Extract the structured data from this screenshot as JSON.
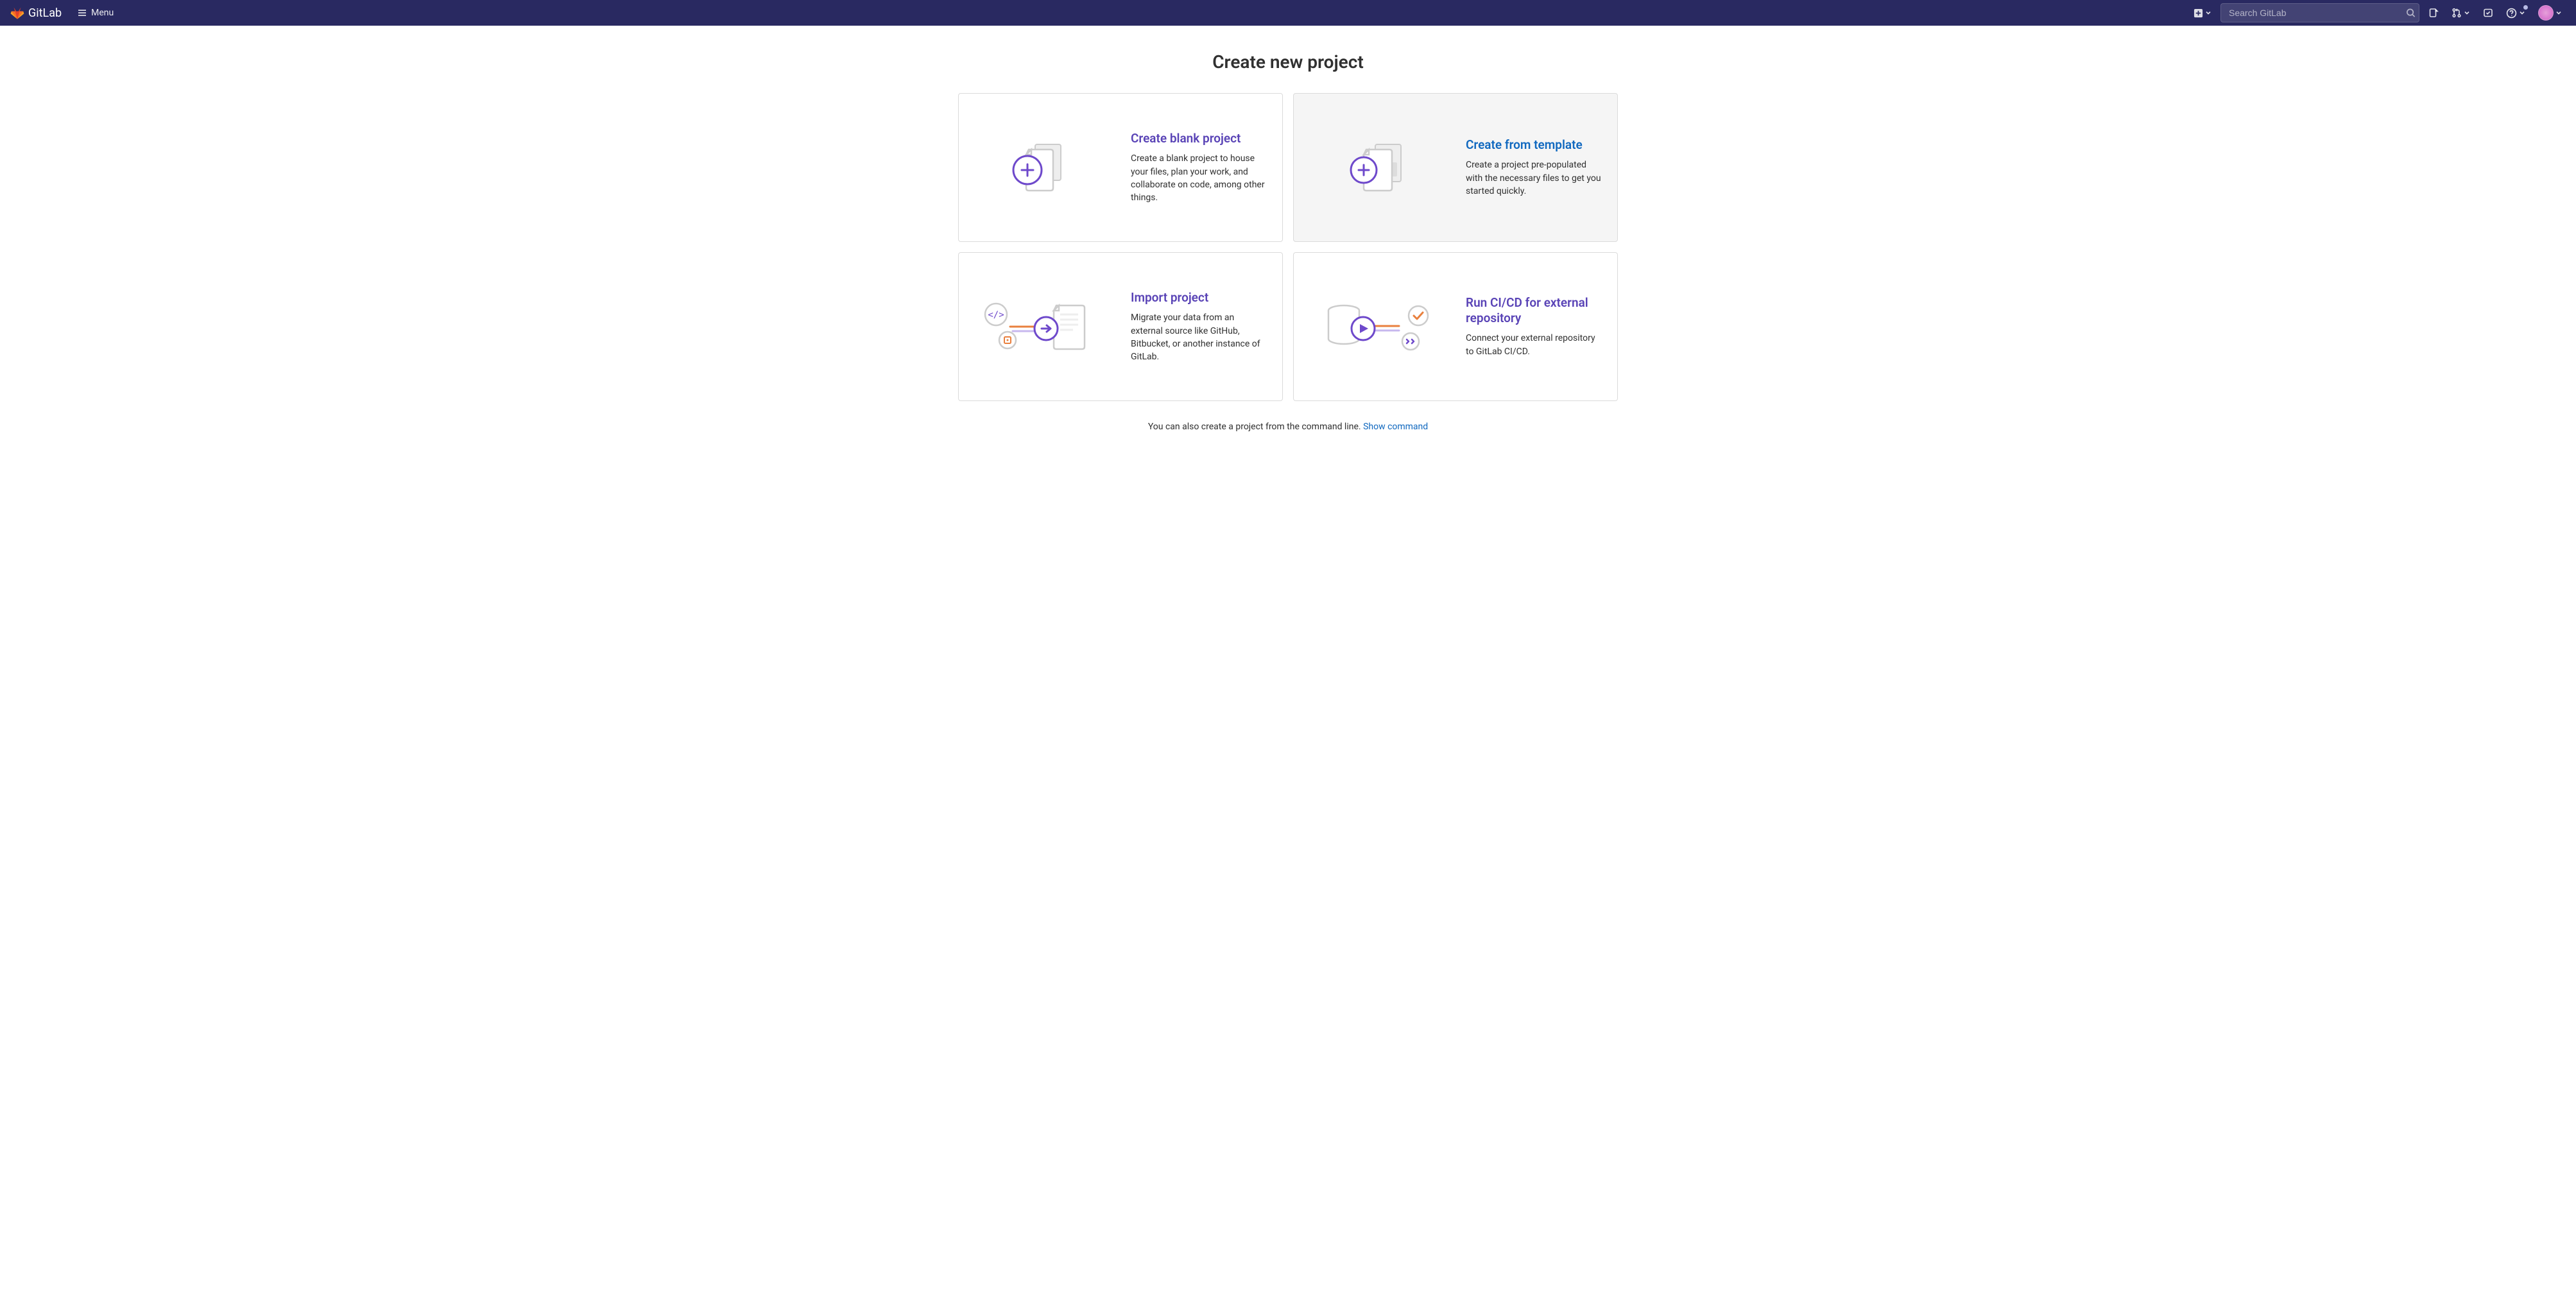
{
  "header": {
    "brand": "GitLab",
    "menu_label": "Menu",
    "search_placeholder": "Search GitLab"
  },
  "page": {
    "title": "Create new project"
  },
  "cards": {
    "blank": {
      "title": "Create blank project",
      "desc": "Create a blank project to house your files, plan your work, and collaborate on code, among other things."
    },
    "template": {
      "title": "Create from template",
      "desc": "Create a project pre-populated with the necessary files to get you started quickly."
    },
    "import": {
      "title": "Import project",
      "desc": "Migrate your data from an external source like GitHub, Bitbucket, or another instance of GitLab."
    },
    "cicd": {
      "title": "Run CI/CD for external repository",
      "desc": "Connect your external repository to GitLab CI/CD."
    }
  },
  "footer": {
    "text": "You can also create a project from the command line. ",
    "link": "Show command"
  }
}
